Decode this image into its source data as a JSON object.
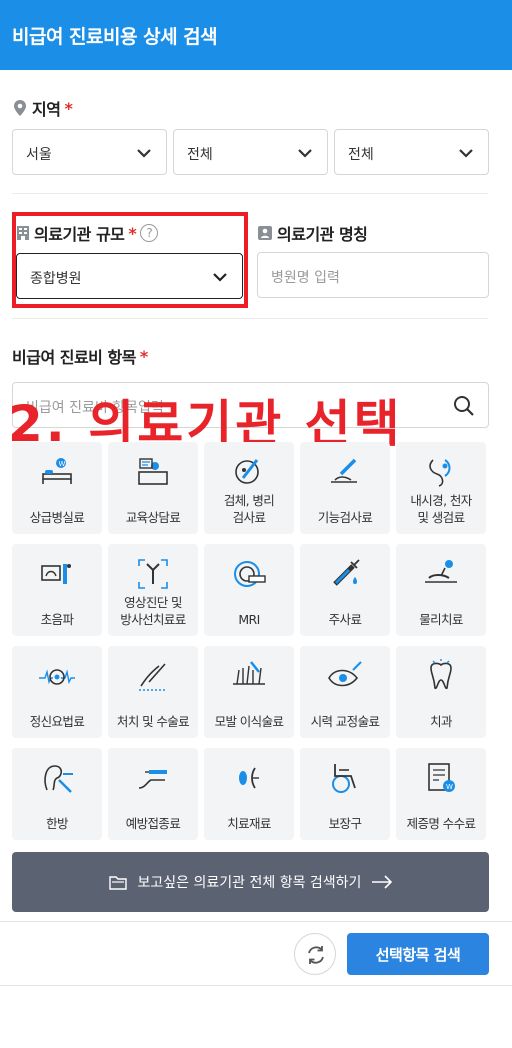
{
  "header": {
    "title": "비급여 진료비용 상세 검색"
  },
  "region": {
    "label": "지역",
    "required_mark": "*",
    "selects": [
      "서울",
      "전체",
      "전체"
    ]
  },
  "institution_scale": {
    "label": "의료기관 규모",
    "required_mark": "*",
    "help_mark": "?",
    "selected": "종합병원"
  },
  "institution_name": {
    "label": "의료기관 명칭",
    "placeholder": "병원명 입력"
  },
  "items": {
    "label": "비급여 진료비 항목",
    "required_mark": "*",
    "search_placeholder": "비급여 진료비 항목입력"
  },
  "annotation": "2. 의료기관 선택",
  "categories": [
    {
      "label": "상급병실료",
      "icon": "bed-icon"
    },
    {
      "label": "교육상담료",
      "icon": "counseling-desk-icon"
    },
    {
      "label": "검체, 병리\n검사료",
      "icon": "specimen-test-icon"
    },
    {
      "label": "기능검사료",
      "icon": "function-test-icon"
    },
    {
      "label": "내시경, 천자\n및 생검료",
      "icon": "endoscope-icon"
    },
    {
      "label": "초음파",
      "icon": "ultrasound-icon"
    },
    {
      "label": "영상진단 및\n방사선치료료",
      "icon": "imaging-icon"
    },
    {
      "label": "MRI",
      "icon": "mri-icon"
    },
    {
      "label": "주사료",
      "icon": "syringe-icon"
    },
    {
      "label": "물리치료",
      "icon": "physical-therapy-icon"
    },
    {
      "label": "정신요법료",
      "icon": "brain-icon"
    },
    {
      "label": "처치 및 수술료",
      "icon": "surgery-icon"
    },
    {
      "label": "모발 이식술료",
      "icon": "hair-transplant-icon"
    },
    {
      "label": "시력 교정술료",
      "icon": "eye-icon"
    },
    {
      "label": "치과",
      "icon": "tooth-icon"
    },
    {
      "label": "한방",
      "icon": "oriental-medicine-icon"
    },
    {
      "label": "예방접종료",
      "icon": "vaccination-icon"
    },
    {
      "label": "치료재료",
      "icon": "medical-material-icon"
    },
    {
      "label": "보장구",
      "icon": "wheelchair-icon"
    },
    {
      "label": "제증명 수수료",
      "icon": "certificate-icon"
    }
  ],
  "full_search_button": "보고싶은 의료기관 전체 항목 검색하기",
  "search_button": "선택항목 검색",
  "colors": {
    "brand": "#1b8ee8",
    "annotation": "#e8232a",
    "search_button": "#2b84e0",
    "full_button": "#5b6372"
  }
}
